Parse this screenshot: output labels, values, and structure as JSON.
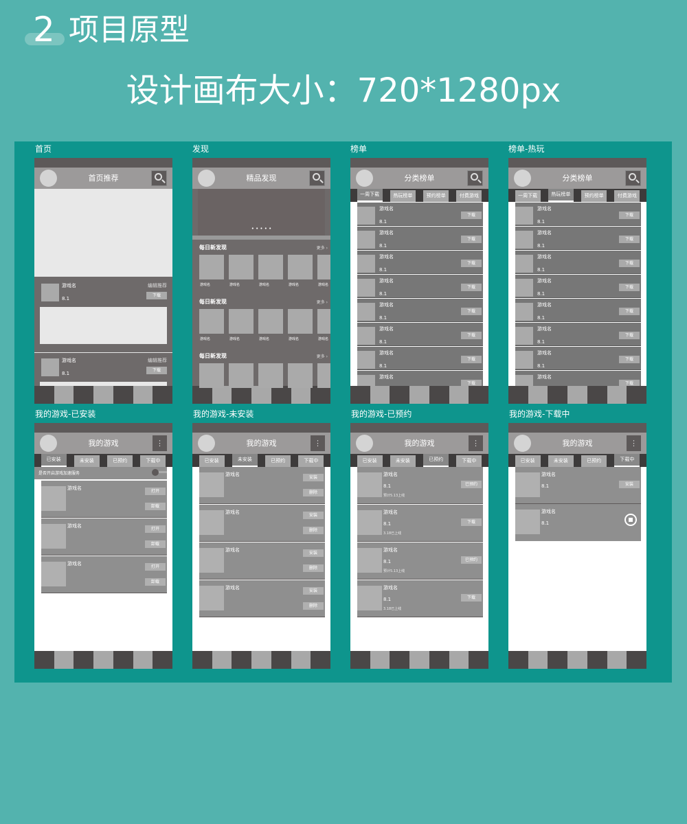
{
  "header": {
    "number": "2",
    "title": "项目原型"
  },
  "subtitle": "设计画布大小：720*1280px",
  "common": {
    "game_name": "游戏名",
    "score": "8.1",
    "download": "下载",
    "open": "打开",
    "uninstall": "卸载",
    "install": "安装",
    "delete": "删除",
    "reserved": "已预约",
    "menu_glyph": "⋮",
    "dots": "• • • • •",
    "more": "更多 ›",
    "editor_rec": "编辑推荐"
  },
  "screens": {
    "home": {
      "caption": "首页",
      "title": "首页推荐"
    },
    "discover": {
      "caption": "发现",
      "title": "精品发现",
      "section": "每日新发现"
    },
    "rank": {
      "caption": "榜单",
      "title": "分类榜单",
      "tabs": [
        "一周下载",
        "热玩榜单",
        "预约榜单",
        "付费游戏"
      ]
    },
    "rank_hot": {
      "caption": "榜单-热玩",
      "title": "分类榜单"
    },
    "mine_installed": {
      "caption": "我的游戏-已安装",
      "title": "我的游戏",
      "toggle_text": "是否开启游戏加速服务"
    },
    "mine_uninstalled": {
      "caption": "我的游戏-未安装",
      "title": "我的游戏"
    },
    "mine_reserved": {
      "caption": "我的游戏-已预约",
      "title": "我的游戏",
      "note_reserve": "预计5.13上线",
      "note_online": "3.18已上线"
    },
    "mine_downloading": {
      "caption": "我的游戏-下载中",
      "title": "我的游戏"
    },
    "mine_tabs": [
      "已安装",
      "未安装",
      "已预约",
      "下载中"
    ]
  }
}
